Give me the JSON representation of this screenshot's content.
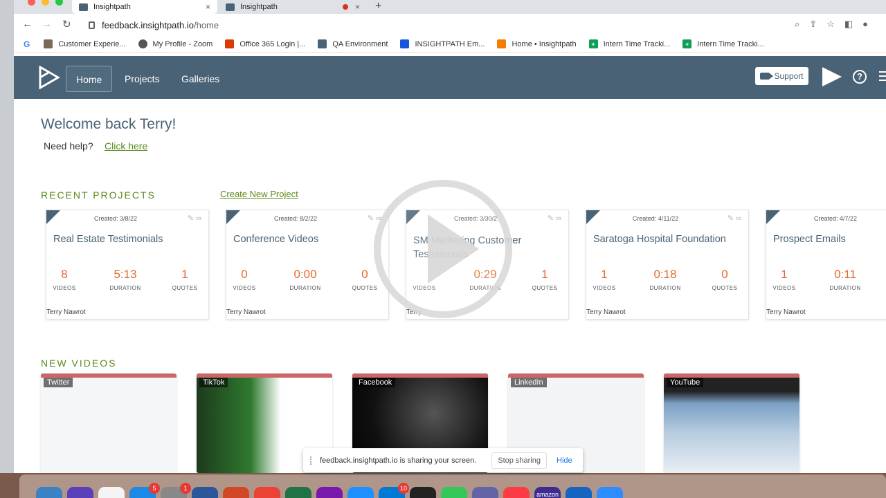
{
  "browser": {
    "tabs": [
      {
        "title": "Insightpath",
        "close": "×"
      },
      {
        "title": "Insightpath",
        "close": "×"
      }
    ],
    "new_tab": "+",
    "url_host": "feedback.insightpath.io",
    "url_path": "/home",
    "bookmarks": [
      {
        "label": "Customer Experie...",
        "icon_color": "#7a6a5a"
      },
      {
        "label": "My Profile - Zoom",
        "icon_color": "#2d8cff"
      },
      {
        "label": "Office 365 Login |...",
        "icon_color": "#d83b01"
      },
      {
        "label": "QA Environment",
        "icon_color": "#4a6275"
      },
      {
        "label": "INSIGHTPATH Em...",
        "icon_color": "#1a56db"
      },
      {
        "label": "Home • Insightpath",
        "icon_color": "#f57c00"
      },
      {
        "label": "Intern Time Tracki...",
        "icon_color": "#0f9d58"
      },
      {
        "label": "Intern Time Tracki...",
        "icon_color": "#0f9d58"
      }
    ]
  },
  "app": {
    "brand_color": "#4a6275",
    "accent_green": "#5a8a1a",
    "accent_orange": "#e36a2c",
    "nav": [
      "Home",
      "Projects",
      "Galleries"
    ],
    "support_label": "Support",
    "welcome": "Welcome back Terry!",
    "need_help": "Need help?",
    "click_here": "Click here",
    "recent_projects_title": "RECENT PROJECTS",
    "create_new_project": "Create New Project",
    "new_videos_title": "NEW VIDEOS",
    "stat_labels": {
      "videos": "VIDEOS",
      "duration": "DURATION",
      "quotes": "QUOTES"
    },
    "projects": [
      {
        "created": "Created: 3/8/22",
        "title": "Real Estate Testimonials",
        "videos": "8",
        "duration": "5:13",
        "quotes": "1",
        "owner": "Terry Nawrot"
      },
      {
        "created": "Created: 8/2/22",
        "title": "Conference Videos",
        "videos": "0",
        "duration": "0:00",
        "quotes": "0",
        "owner": "Terry Nawrot"
      },
      {
        "created": "Created: 3/30/2",
        "title": "SM Marketing Customer Testimonials",
        "videos": "",
        "duration": "0:29",
        "quotes": "1",
        "owner": "Terry"
      },
      {
        "created": "Created: 4/11/22",
        "title": "Saratoga Hospital Foundation",
        "videos": "1",
        "duration": "0:18",
        "quotes": "0",
        "owner": "Terry Nawrot"
      },
      {
        "created": "Created: 4/7/22",
        "title": "Prospect Emails",
        "videos": "1",
        "duration": "0:11",
        "quotes": "",
        "owner": "Terry Nawrot"
      }
    ],
    "videos": [
      {
        "label": "Twitter"
      },
      {
        "label": "TikTok"
      },
      {
        "label": "Facebook"
      },
      {
        "label": "LinkedIn"
      },
      {
        "label": "YouTube"
      }
    ],
    "screen_share": {
      "message": "feedback.insightpath.io is sharing your screen.",
      "stop": "Stop sharing",
      "hide": "Hide"
    }
  },
  "dock": {
    "badges": [
      "5",
      "1",
      "10"
    ],
    "amazon_label": "amazon"
  }
}
